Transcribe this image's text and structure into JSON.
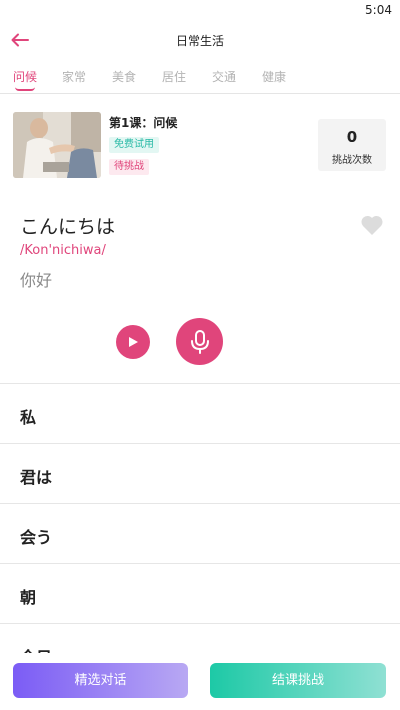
{
  "status_bar": {
    "time": "5:04"
  },
  "header": {
    "title": "日常生活",
    "back_icon": "arrow-left-icon"
  },
  "tabs": [
    {
      "label": "问候",
      "active": true
    },
    {
      "label": "家常",
      "active": false
    },
    {
      "label": "美食",
      "active": false
    },
    {
      "label": "居住",
      "active": false
    },
    {
      "label": "交通",
      "active": false
    },
    {
      "label": "健康",
      "active": false
    }
  ],
  "lesson": {
    "title": "第1课：问候",
    "badge_free": "免费试用",
    "badge_pending": "待挑战",
    "stat_count": "0",
    "stat_label": "挑战次数"
  },
  "current_word": {
    "text": "こんにちは",
    "romaji": "/Kon'nichiwa/",
    "meaning": "你好",
    "favorite_icon": "heart-icon"
  },
  "controls": {
    "play_icon": "play-icon",
    "record_icon": "microphone-icon"
  },
  "word_list": [
    {
      "text": "私"
    },
    {
      "text": "君は"
    },
    {
      "text": "会う"
    },
    {
      "text": "朝"
    },
    {
      "text": "今日"
    }
  ],
  "bottom_bar": {
    "dialog_label": "精选对话",
    "challenge_label": "结课挑战"
  },
  "colors": {
    "accent": "#e0457b",
    "teal": "#27b9a5",
    "purple": "#7b5cf5"
  }
}
